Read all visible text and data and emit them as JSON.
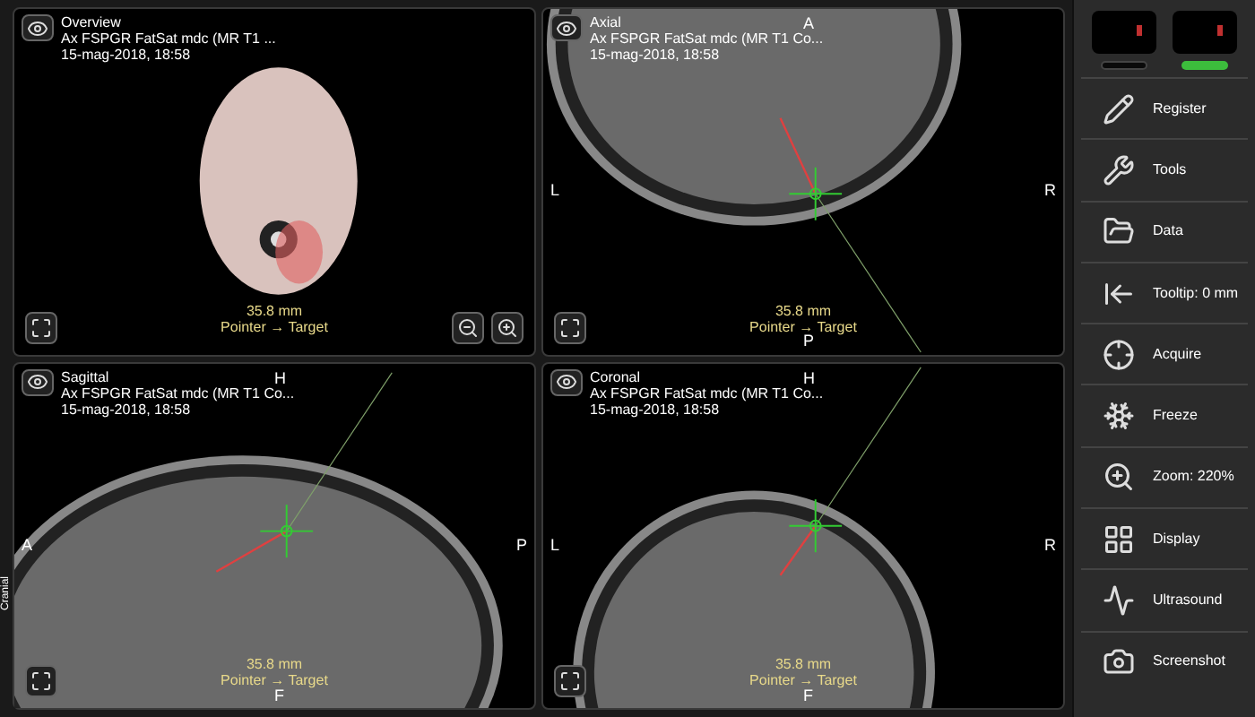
{
  "viewports": [
    {
      "kind": "overview",
      "title": "Overview",
      "series": "Ax FSPGR FatSat mdc (MR T1 ...",
      "date": "15-mag-2018, 18:58",
      "distance": "35.8 mm",
      "measure_label": "Pointer → Target",
      "zoom_controls": true
    },
    {
      "kind": "axial",
      "title": "Axial",
      "series": "Ax FSPGR FatSat mdc (MR T1 Co...",
      "date": "15-mag-2018, 18:58",
      "orientation": {
        "top": "A",
        "left": "L",
        "right": "R",
        "bottom": "P"
      },
      "distance": "35.8 mm",
      "measure_label": "Pointer → Target",
      "zoom_controls": false
    },
    {
      "kind": "sagittal",
      "title": "Sagittal",
      "series": "Ax FSPGR FatSat mdc (MR T1 Co...",
      "date": "15-mag-2018, 18:58",
      "orientation": {
        "top": "H",
        "left": "A",
        "right": "P",
        "bottom": "F"
      },
      "side_label": "Cranial",
      "distance": "35.8 mm",
      "measure_label": "Pointer → Target",
      "zoom_controls": false
    },
    {
      "kind": "coronal",
      "title": "Coronal",
      "series": "Ax FSPGR FatSat mdc (MR T1 Co...",
      "date": "15-mag-2018, 18:58",
      "orientation": {
        "top": "H",
        "left": "L",
        "right": "R",
        "bottom": "F"
      },
      "distance": "35.8 mm",
      "measure_label": "Pointer → Target",
      "zoom_controls": false
    }
  ],
  "trackers": [
    {
      "active": false
    },
    {
      "active": true
    }
  ],
  "menu": [
    {
      "kind": "register",
      "label": "Register"
    },
    {
      "kind": "tools",
      "label": "Tools"
    },
    {
      "kind": "data",
      "label": "Data"
    },
    {
      "kind": "tooltip",
      "label": "Tooltip: 0 mm"
    },
    {
      "kind": "acquire",
      "label": "Acquire"
    },
    {
      "kind": "freeze",
      "label": "Freeze"
    },
    {
      "kind": "zoom",
      "label": "Zoom: 220%"
    },
    {
      "kind": "display",
      "label": "Display"
    },
    {
      "kind": "ultrasound",
      "label": "Ultrasound"
    },
    {
      "kind": "screenshot",
      "label": "Screenshot"
    }
  ]
}
